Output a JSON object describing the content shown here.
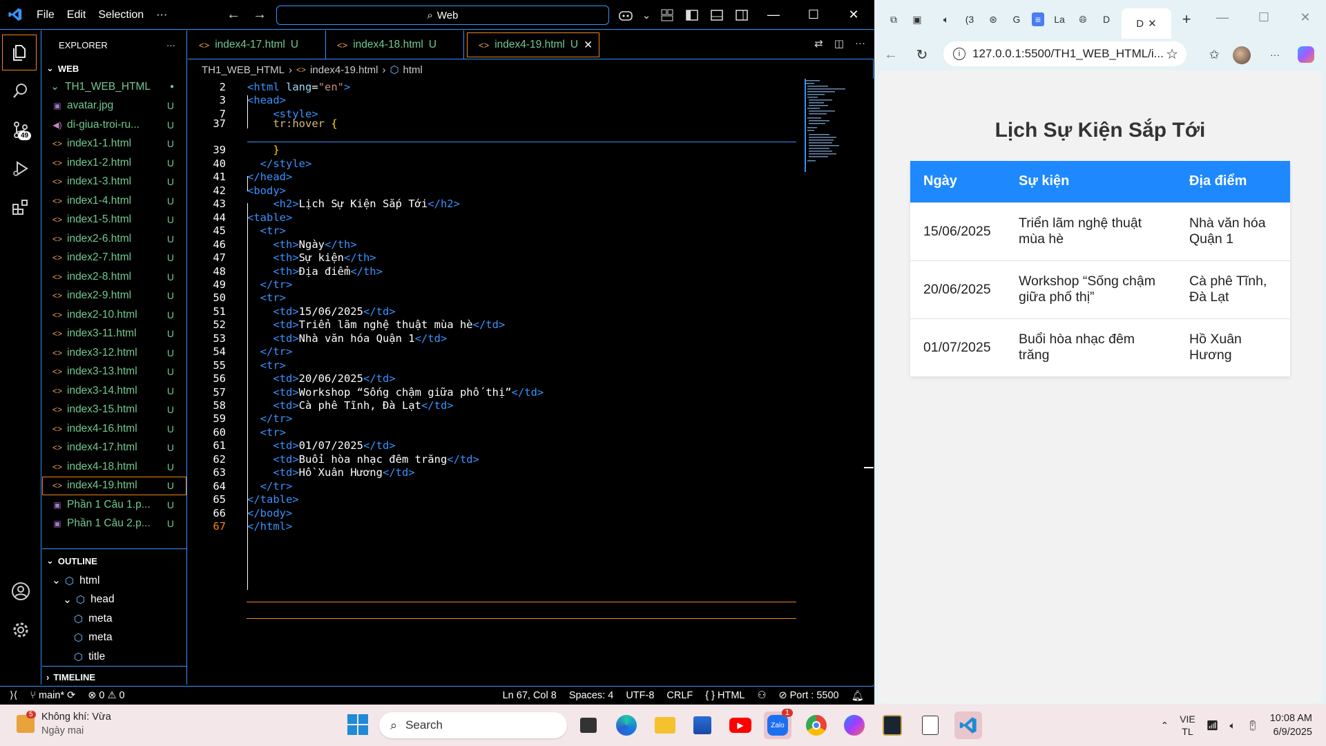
{
  "vscode": {
    "menu": [
      "File",
      "Edit",
      "Selection"
    ],
    "command_center": "Web",
    "tabs": [
      {
        "label": "index4-17.html",
        "status": "U"
      },
      {
        "label": "index4-18.html",
        "status": "U"
      },
      {
        "label": "index4-19.html",
        "status": "U"
      }
    ],
    "explorer_title": "EXPLORER",
    "workspace_section": "WEB",
    "root_folder": "TH1_WEB_HTML",
    "files": [
      {
        "name": "avatar.jpg",
        "status": "U",
        "kind": "image"
      },
      {
        "name": "di-giua-troi-ru...",
        "status": "U",
        "kind": "audio"
      },
      {
        "name": "index1-1.html",
        "status": "U",
        "kind": "html"
      },
      {
        "name": "index1-2.html",
        "status": "U",
        "kind": "html"
      },
      {
        "name": "index1-3.html",
        "status": "U",
        "kind": "html"
      },
      {
        "name": "index1-4.html",
        "status": "U",
        "kind": "html"
      },
      {
        "name": "index1-5.html",
        "status": "U",
        "kind": "html"
      },
      {
        "name": "index2-6.html",
        "status": "U",
        "kind": "html"
      },
      {
        "name": "index2-7.html",
        "status": "U",
        "kind": "html"
      },
      {
        "name": "index2-8.html",
        "status": "U",
        "kind": "html"
      },
      {
        "name": "index2-9.html",
        "status": "U",
        "kind": "html"
      },
      {
        "name": "index2-10.html",
        "status": "U",
        "kind": "html"
      },
      {
        "name": "index3-11.html",
        "status": "U",
        "kind": "html"
      },
      {
        "name": "index3-12.html",
        "status": "U",
        "kind": "html"
      },
      {
        "name": "index3-13.html",
        "status": "U",
        "kind": "html"
      },
      {
        "name": "index3-14.html",
        "status": "U",
        "kind": "html"
      },
      {
        "name": "index3-15.html",
        "status": "U",
        "kind": "html"
      },
      {
        "name": "index4-16.html",
        "status": "U",
        "kind": "html"
      },
      {
        "name": "index4-17.html",
        "status": "U",
        "kind": "html"
      },
      {
        "name": "index4-18.html",
        "status": "U",
        "kind": "html"
      },
      {
        "name": "index4-19.html",
        "status": "U",
        "kind": "html",
        "selected": true
      },
      {
        "name": "Phần 1 Câu 1.p...",
        "status": "U",
        "kind": "image"
      },
      {
        "name": "Phần 1 Câu 2.p...",
        "status": "U",
        "kind": "image"
      }
    ],
    "outline_section": "OUTLINE",
    "outline": [
      {
        "label": "html",
        "level": 0
      },
      {
        "label": "head",
        "level": 1
      },
      {
        "label": "meta",
        "level": 2
      },
      {
        "label": "meta",
        "level": 2
      },
      {
        "label": "title",
        "level": 2
      }
    ],
    "timeline_section": "TIMELINE",
    "breadcrumb": [
      "TH1_WEB_HTML",
      "index4-19.html",
      "html"
    ],
    "code_lines": [
      {
        "n": "2",
        "html": "<span class='t'>&lt;html</span> <span class='a'>lang</span>=<span class='s'>\"en\"</span><span class='t'>&gt;</span>"
      },
      {
        "n": "3",
        "html": "<span class='t'>&lt;head&gt;</span>"
      },
      {
        "n": "7",
        "html": "    <span class='t'>&lt;style&gt;</span>"
      },
      {
        "n": "37",
        "html": "    <span class='sel-css'>tr:hover</span> <span class='br'>{</span>"
      },
      {
        "n": "39",
        "html": "    <span class='br'>}</span>"
      },
      {
        "n": "40",
        "html": "  <span class='t'>&lt;/style&gt;</span>"
      },
      {
        "n": "41",
        "html": "<span class='t'>&lt;/head&gt;</span>"
      },
      {
        "n": "42",
        "html": "<span class='t'>&lt;body&gt;</span>"
      },
      {
        "n": "43",
        "html": "    <span class='t'>&lt;h2&gt;</span>Lịch Sự Kiện Sắp Tới<span class='t'>&lt;/h2&gt;</span>"
      },
      {
        "n": "44",
        "html": "<span class='t'>&lt;table&gt;</span>"
      },
      {
        "n": "45",
        "html": "  <span class='t'>&lt;tr&gt;</span>"
      },
      {
        "n": "46",
        "html": "    <span class='t'>&lt;th&gt;</span>Ngày<span class='t'>&lt;/th&gt;</span>"
      },
      {
        "n": "47",
        "html": "    <span class='t'>&lt;th&gt;</span>Sự kiện<span class='t'>&lt;/th&gt;</span>"
      },
      {
        "n": "48",
        "html": "    <span class='t'>&lt;th&gt;</span>Địa điểm<span class='t'>&lt;/th&gt;</span>"
      },
      {
        "n": "49",
        "html": "  <span class='t'>&lt;/tr&gt;</span>"
      },
      {
        "n": "50",
        "html": "  <span class='t'>&lt;tr&gt;</span>"
      },
      {
        "n": "51",
        "html": "    <span class='t'>&lt;td&gt;</span>15/06/2025<span class='t'>&lt;/td&gt;</span>"
      },
      {
        "n": "52",
        "html": "    <span class='t'>&lt;td&gt;</span>Triển lãm nghệ thuật mùa hè<span class='t'>&lt;/td&gt;</span>"
      },
      {
        "n": "53",
        "html": "    <span class='t'>&lt;td&gt;</span>Nhà văn hóa Quận 1<span class='t'>&lt;/td&gt;</span>"
      },
      {
        "n": "54",
        "html": "  <span class='t'>&lt;/tr&gt;</span>"
      },
      {
        "n": "55",
        "html": "  <span class='t'>&lt;tr&gt;</span>"
      },
      {
        "n": "56",
        "html": "    <span class='t'>&lt;td&gt;</span>20/06/2025<span class='t'>&lt;/td&gt;</span>"
      },
      {
        "n": "57",
        "html": "    <span class='t'>&lt;td&gt;</span>Workshop “Sống chậm giữa phố thị”<span class='t'>&lt;/td&gt;</span>"
      },
      {
        "n": "58",
        "html": "    <span class='t'>&lt;td&gt;</span>Cà phê Tĩnh, Đà Lạt<span class='t'>&lt;/td&gt;</span>"
      },
      {
        "n": "59",
        "html": "  <span class='t'>&lt;/tr&gt;</span>"
      },
      {
        "n": "60",
        "html": "  <span class='t'>&lt;tr&gt;</span>"
      },
      {
        "n": "61",
        "html": "    <span class='t'>&lt;td&gt;</span>01/07/2025<span class='t'>&lt;/td&gt;</span>"
      },
      {
        "n": "62",
        "html": "    <span class='t'>&lt;td&gt;</span>Buổi hòa nhạc đêm trăng<span class='t'>&lt;/td&gt;</span>"
      },
      {
        "n": "63",
        "html": "    <span class='t'>&lt;td&gt;</span>Hồ Xuân Hương<span class='t'>&lt;/td&gt;</span>"
      },
      {
        "n": "64",
        "html": "  <span class='t'>&lt;/tr&gt;</span>"
      },
      {
        "n": "65",
        "html": "<span class='t'>&lt;/table&gt;</span>"
      },
      {
        "n": "66",
        "html": "<span class='t'>&lt;/body&gt;</span>"
      },
      {
        "n": "67",
        "html": "<span class='t'>&lt;/html&gt;</span>",
        "current": true
      }
    ],
    "status": {
      "branch": "main*",
      "errors": "0",
      "warnings": "0",
      "position": "Ln 67, Col 8",
      "spaces": "Spaces: 4",
      "encoding": "UTF-8",
      "eol": "CRLF",
      "language": "HTML",
      "port": "Port : 5500"
    },
    "scm_badge": "49"
  },
  "browser": {
    "tabs_short": [
      "(3",
      "G",
      "La",
      "D",
      "D"
    ],
    "url": "127.0.0.1:5500/TH1_WEB_HTML/i...",
    "page_title": "Lịch Sự Kiện Sắp Tới",
    "table_headers": [
      "Ngày",
      "Sự kiện",
      "Địa điểm"
    ],
    "table_rows": [
      [
        "15/06/2025",
        "Triển lãm nghệ thuật mùa hè",
        "Nhà văn hóa Quận 1"
      ],
      [
        "20/06/2025",
        "Workshop “Sống chậm giữa phố thị”",
        "Cà phê Tĩnh, Đà Lạt"
      ],
      [
        "01/07/2025",
        "Buổi hòa nhạc đêm trăng",
        "Hồ Xuân Hương"
      ]
    ],
    "header_color": "#1e88ff"
  },
  "taskbar": {
    "weather_title": "Không khí: Vừa",
    "weather_sub": "Ngày mai",
    "weather_badge": "5",
    "search_placeholder": "Search",
    "zalo_badge": "1",
    "lang_top": "VIE",
    "lang_bottom": "TL",
    "time": "10:08 AM",
    "date": "6/9/2025"
  },
  "colors": {
    "vscode_border": "#3794ff",
    "focus_orange": "#f38518",
    "untracked_green": "#73c991"
  }
}
